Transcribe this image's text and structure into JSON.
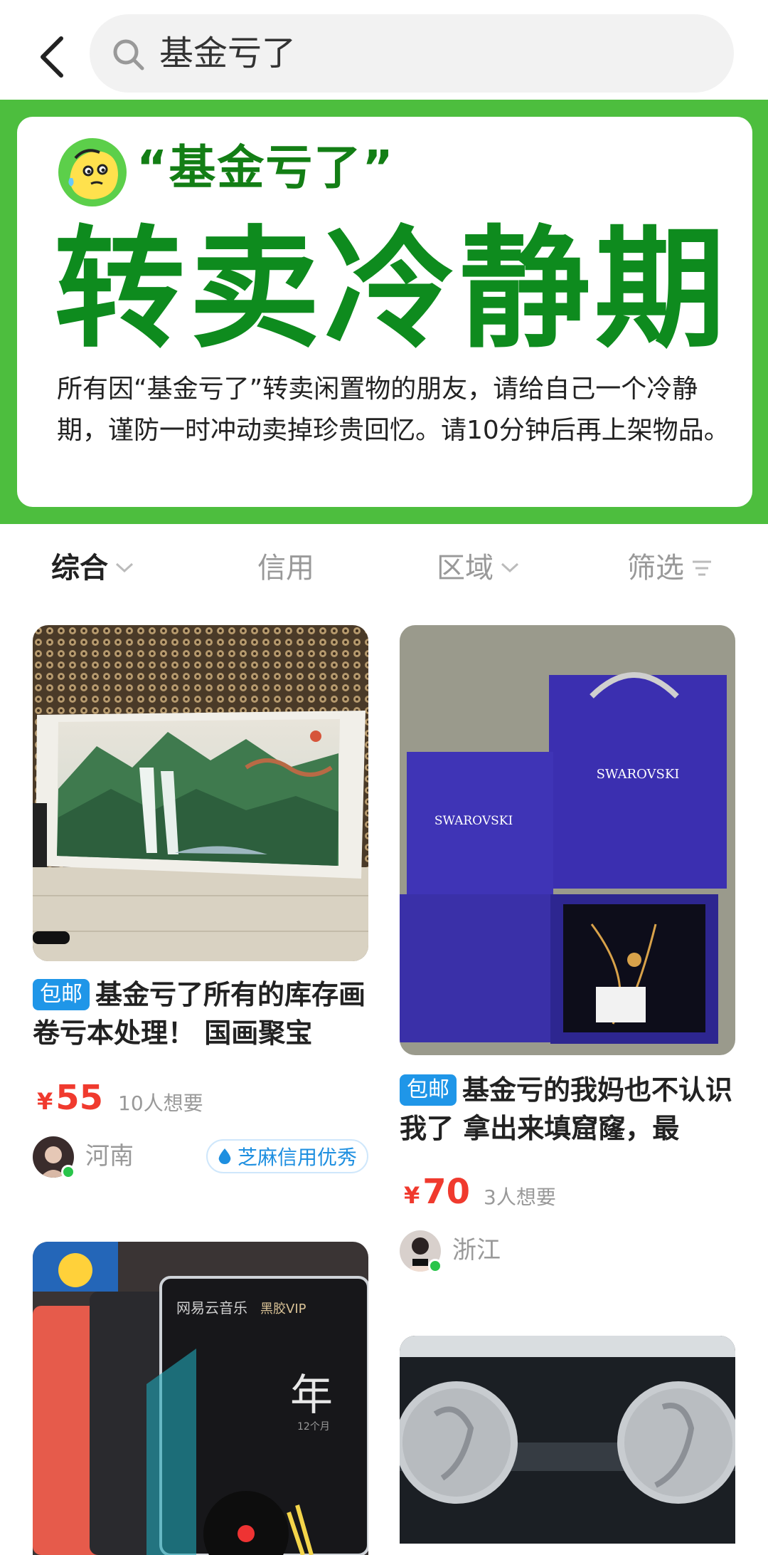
{
  "search": {
    "query": "基金亏了"
  },
  "banner": {
    "quote_title": "“基金亏了”",
    "big_title": "转卖冷静期",
    "description": "所有因“基金亏了”转卖闲置物的朋友，请给自己一个冷静期，谨防一时冲动卖掉珍贵回忆。请10分钟后再上架物品。"
  },
  "sort_tabs": [
    {
      "label": "综合",
      "active": true
    },
    {
      "label": "信用"
    },
    {
      "label": "区域"
    },
    {
      "label": "筛选"
    }
  ],
  "items": [
    {
      "tag": "包邮",
      "title": "基金亏了所有的库存画卷亏本处理！ 国画聚宝",
      "currency": "¥",
      "price": "55",
      "want": "10人想要",
      "region": "河南",
      "credit_badge": "芝麻信用优秀"
    },
    {
      "tag": "包邮",
      "title": "基金亏的我妈也不认识我了 拿出来填窟窿，最",
      "currency": "¥",
      "price": "70",
      "want": "3人想要",
      "region": "浙江",
      "brand_text_1": "SWAROVSKI",
      "brand_text_2": "SWAROVSKI"
    },
    {
      "photo_text_1": "网易云音乐",
      "photo_text_2": "黑胶VIP",
      "photo_text_3": "年",
      "photo_text_4": "12个月"
    },
    {}
  ],
  "colors": {
    "accent_green": "#4dbe3e",
    "title_green": "#0e8b1e",
    "price_red": "#f03a2e",
    "tag_blue": "#1f96e8"
  }
}
